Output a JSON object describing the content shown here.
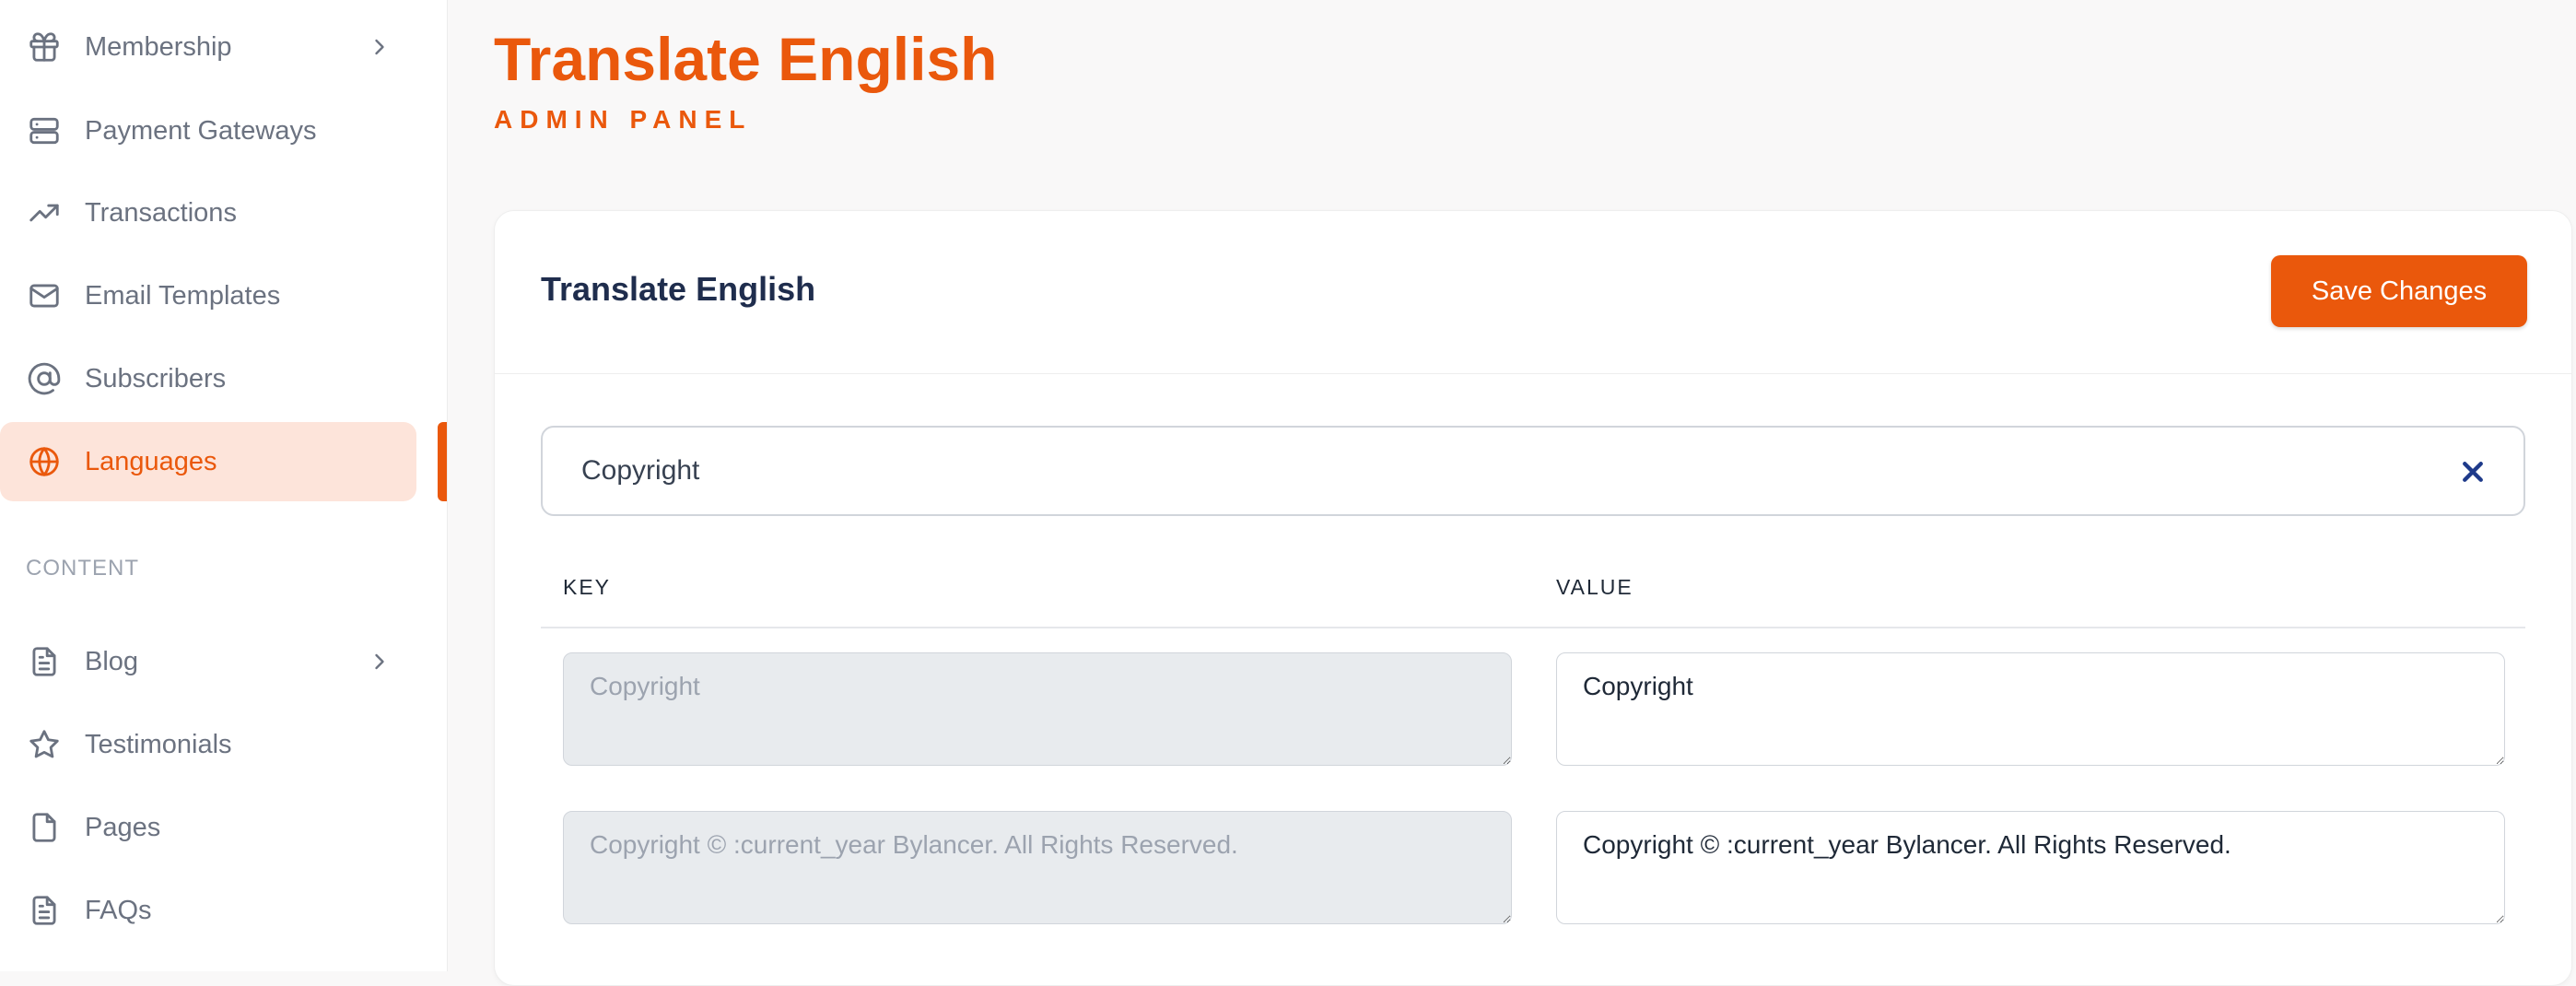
{
  "sidebar": {
    "items": [
      {
        "label": "Membership",
        "icon": "gift-icon"
      },
      {
        "label": "Payment Gateways",
        "icon": "server-icon"
      },
      {
        "label": "Transactions",
        "icon": "trending-up-icon"
      },
      {
        "label": "Email Templates",
        "icon": "mail-icon"
      },
      {
        "label": "Subscribers",
        "icon": "at-sign-icon"
      },
      {
        "label": "Languages",
        "icon": "globe-icon",
        "active": true
      }
    ],
    "content_section": "CONTENT",
    "content_items": [
      {
        "label": "Blog",
        "icon": "document-icon"
      },
      {
        "label": "Testimonials",
        "icon": "star-icon"
      },
      {
        "label": "Pages",
        "icon": "file-icon"
      },
      {
        "label": "FAQs",
        "icon": "document-icon"
      }
    ]
  },
  "header": {
    "title": "Translate English",
    "subtitle": "ADMIN PANEL"
  },
  "card": {
    "title": "Translate English",
    "save_label": "Save Changes",
    "search_value": "Copyright",
    "columns": {
      "key": "KEY",
      "value": "VALUE"
    },
    "rows": [
      {
        "key": "Copyright",
        "value": "Copyright"
      },
      {
        "key": "Copyright © :current_year Bylancer. All Rights Reserved.",
        "value": "Copyright © :current_year Bylancer. All Rights Reserved."
      }
    ]
  },
  "colors": {
    "accent": "#ea580c",
    "active_bg": "#fde4da",
    "text_muted": "#6b7280"
  }
}
